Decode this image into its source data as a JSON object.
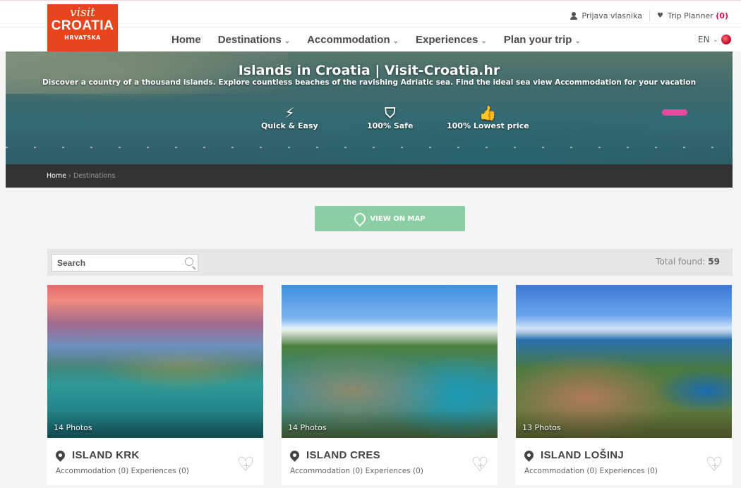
{
  "topbar": {
    "login_label": "Prijava vlasnika",
    "planner_label": "Trip Planner",
    "planner_count": "(0)"
  },
  "logo": {
    "line1": "visit",
    "line2": "CROATIA",
    "line3": "HRVATSKA"
  },
  "nav": {
    "items": [
      {
        "label": "Home",
        "has_dropdown": false
      },
      {
        "label": "Destinations",
        "has_dropdown": true
      },
      {
        "label": "Accommodation",
        "has_dropdown": true
      },
      {
        "label": "Experiences",
        "has_dropdown": true
      },
      {
        "label": "Plan your trip",
        "has_dropdown": true
      }
    ],
    "language": "EN"
  },
  "hero": {
    "title": "Islands in Croatia | Visit-Croatia.hr",
    "subtitle": "Discover a country of a thousand islands. Explore countless beaches of the ravishing Adriatic sea. Find the ideal sea view Accommodation for your vacation",
    "features": [
      {
        "icon": "lightning-icon",
        "label": "Quick & Easy"
      },
      {
        "icon": "shield-icon",
        "label": "100% Safe"
      },
      {
        "icon": "thumbs-up-icon",
        "label": "100% Lowest price"
      }
    ]
  },
  "breadcrumb": {
    "home": "Home",
    "separator": "›",
    "current": "Destinations"
  },
  "map_button": {
    "label": "VIEW ON MAP"
  },
  "filter": {
    "search_placeholder": "Search",
    "total_label": "Total found:",
    "total_value": "59"
  },
  "cards": [
    {
      "photos": "14 Photos",
      "name": "ISLAND KRK",
      "meta": "Accommodation (0) Experiences (0)"
    },
    {
      "photos": "14 Photos",
      "name": "ISLAND CRES",
      "meta": "Accommodation (0) Experiences (0)"
    },
    {
      "photos": "13 Photos",
      "name": "ISLAND LOŠINJ",
      "meta": "Accommodation (0) Experiences (0)"
    }
  ],
  "colors": {
    "brand": "#e8451e",
    "accent_pink": "#d6134a",
    "map_button": "#8ccea3",
    "breadcrumb_bar": "#333333"
  }
}
